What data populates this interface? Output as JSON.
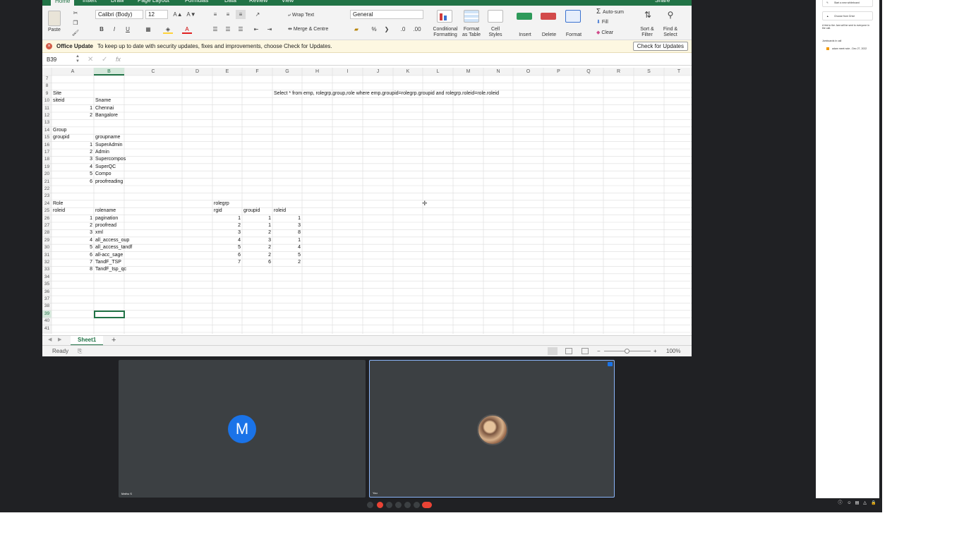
{
  "excel": {
    "tabs": [
      "Home",
      "Insert",
      "Draw",
      "Page Layout",
      "Formulas",
      "Data",
      "Review",
      "View"
    ],
    "share_label": "Share",
    "ribbon": {
      "paste": "Paste",
      "font_name": "Calibri (Body)",
      "font_size": "12",
      "wrap_text": "Wrap Text",
      "merge_centre": "Merge & Centre",
      "number_format": "General",
      "conditional_formatting": [
        "Conditional",
        "Formatting"
      ],
      "format_as_table": [
        "Format",
        "as Table"
      ],
      "cell_styles": [
        "Cell",
        "Styles"
      ],
      "insert": "Insert",
      "delete": "Delete",
      "format": "Format",
      "autosum": "Auto-sum",
      "fill": "Fill",
      "clear": "Clear",
      "sort_filter": [
        "Sort &",
        "Filter"
      ],
      "find_select": [
        "Find &",
        "Select"
      ],
      "bold": "B",
      "italic": "I",
      "underline": "U",
      "percent": "%"
    },
    "message_bar": {
      "title": "Office Update",
      "text": "To keep up to date with security updates, fixes and improvements, choose Check for Updates.",
      "button": "Check for Updates"
    },
    "formula_bar": {
      "name_box": "B39",
      "fx": "fx",
      "formula": ""
    },
    "columns": [
      "A",
      "B",
      "C",
      "D",
      "E",
      "F",
      "G",
      "H",
      "I",
      "J",
      "K",
      "L",
      "M",
      "N",
      "O",
      "P",
      "Q",
      "R",
      "S",
      "T"
    ],
    "rows": [
      7,
      8,
      9,
      10,
      11,
      12,
      13,
      14,
      15,
      16,
      17,
      18,
      19,
      20,
      21,
      22,
      23,
      24,
      25,
      26,
      27,
      28,
      29,
      30,
      31,
      32,
      33,
      34,
      35,
      36,
      37,
      38,
      39,
      40,
      41
    ],
    "cells": [
      {
        "r": 9,
        "c": "A",
        "v": "Site"
      },
      {
        "r": 9,
        "c": "G",
        "v": "Select * from emp, rolegrp,group,role where emp.groupid=rolegrp.groupid and rolegrp.roleid=role.roleid"
      },
      {
        "r": 10,
        "c": "A",
        "v": "siteid"
      },
      {
        "r": 10,
        "c": "B",
        "v": "Sname"
      },
      {
        "r": 11,
        "c": "A",
        "v": "1",
        "num": true
      },
      {
        "r": 11,
        "c": "B",
        "v": "Chennai"
      },
      {
        "r": 12,
        "c": "A",
        "v": "2",
        "num": true
      },
      {
        "r": 12,
        "c": "B",
        "v": "Bangalore"
      },
      {
        "r": 14,
        "c": "A",
        "v": "Group"
      },
      {
        "r": 15,
        "c": "A",
        "v": "groupid"
      },
      {
        "r": 15,
        "c": "B",
        "v": "groupname"
      },
      {
        "r": 16,
        "c": "A",
        "v": "1",
        "num": true
      },
      {
        "r": 16,
        "c": "B",
        "v": "SuperAdmin"
      },
      {
        "r": 17,
        "c": "A",
        "v": "2",
        "num": true
      },
      {
        "r": 17,
        "c": "B",
        "v": "Admin"
      },
      {
        "r": 18,
        "c": "A",
        "v": "3",
        "num": true
      },
      {
        "r": 18,
        "c": "B",
        "v": "Supercompos"
      },
      {
        "r": 19,
        "c": "A",
        "v": "4",
        "num": true
      },
      {
        "r": 19,
        "c": "B",
        "v": "SuperQC"
      },
      {
        "r": 20,
        "c": "A",
        "v": "5",
        "num": true
      },
      {
        "r": 20,
        "c": "B",
        "v": "Compo"
      },
      {
        "r": 21,
        "c": "A",
        "v": "6",
        "num": true
      },
      {
        "r": 21,
        "c": "B",
        "v": "proofreading"
      },
      {
        "r": 24,
        "c": "A",
        "v": "Role"
      },
      {
        "r": 24,
        "c": "E",
        "v": "rolegrp"
      },
      {
        "r": 25,
        "c": "A",
        "v": "roleid"
      },
      {
        "r": 25,
        "c": "B",
        "v": "rolename"
      },
      {
        "r": 25,
        "c": "E",
        "v": "rgid"
      },
      {
        "r": 25,
        "c": "F",
        "v": "groupid"
      },
      {
        "r": 25,
        "c": "G",
        "v": "roleid"
      },
      {
        "r": 26,
        "c": "A",
        "v": "1",
        "num": true
      },
      {
        "r": 26,
        "c": "B",
        "v": "pagination"
      },
      {
        "r": 26,
        "c": "E",
        "v": "1",
        "num": true
      },
      {
        "r": 26,
        "c": "F",
        "v": "1",
        "num": true
      },
      {
        "r": 26,
        "c": "G",
        "v": "1",
        "num": true
      },
      {
        "r": 27,
        "c": "A",
        "v": "2",
        "num": true
      },
      {
        "r": 27,
        "c": "B",
        "v": "proofread"
      },
      {
        "r": 27,
        "c": "E",
        "v": "2",
        "num": true
      },
      {
        "r": 27,
        "c": "F",
        "v": "1",
        "num": true
      },
      {
        "r": 27,
        "c": "G",
        "v": "3",
        "num": true
      },
      {
        "r": 28,
        "c": "A",
        "v": "3",
        "num": true
      },
      {
        "r": 28,
        "c": "B",
        "v": "xml"
      },
      {
        "r": 28,
        "c": "E",
        "v": "3",
        "num": true
      },
      {
        "r": 28,
        "c": "F",
        "v": "2",
        "num": true
      },
      {
        "r": 28,
        "c": "G",
        "v": "8",
        "num": true
      },
      {
        "r": 29,
        "c": "A",
        "v": "4",
        "num": true
      },
      {
        "r": 29,
        "c": "B",
        "v": "all_access_oup"
      },
      {
        "r": 29,
        "c": "E",
        "v": "4",
        "num": true
      },
      {
        "r": 29,
        "c": "F",
        "v": "3",
        "num": true
      },
      {
        "r": 29,
        "c": "G",
        "v": "1",
        "num": true
      },
      {
        "r": 30,
        "c": "A",
        "v": "5",
        "num": true
      },
      {
        "r": 30,
        "c": "B",
        "v": "all_access_tandf"
      },
      {
        "r": 30,
        "c": "E",
        "v": "5",
        "num": true
      },
      {
        "r": 30,
        "c": "F",
        "v": "2",
        "num": true
      },
      {
        "r": 30,
        "c": "G",
        "v": "4",
        "num": true
      },
      {
        "r": 31,
        "c": "A",
        "v": "6",
        "num": true
      },
      {
        "r": 31,
        "c": "B",
        "v": "all-acc_sage"
      },
      {
        "r": 31,
        "c": "E",
        "v": "6",
        "num": true
      },
      {
        "r": 31,
        "c": "F",
        "v": "2",
        "num": true
      },
      {
        "r": 31,
        "c": "G",
        "v": "5",
        "num": true
      },
      {
        "r": 32,
        "c": "A",
        "v": "7",
        "num": true
      },
      {
        "r": 32,
        "c": "B",
        "v": "TandF_TSP"
      },
      {
        "r": 32,
        "c": "E",
        "v": "7",
        "num": true
      },
      {
        "r": 32,
        "c": "F",
        "v": "6",
        "num": true
      },
      {
        "r": 32,
        "c": "G",
        "v": "2",
        "num": true
      },
      {
        "r": 33,
        "c": "A",
        "v": "8",
        "num": true
      },
      {
        "r": 33,
        "c": "B",
        "v": "TandF_tsp_qc"
      }
    ],
    "selected_cell": {
      "r": 39,
      "c": "B"
    },
    "sheet_tab": "Sheet1",
    "add_sheet": "+",
    "status": "Ready",
    "zoom": "100%",
    "colors": {
      "accent": "#217346",
      "message_bar": "#fdf7e1"
    }
  },
  "meet": {
    "tile1": {
      "avatar_letter": "M",
      "name": "Mathu S"
    },
    "tile2": {
      "name": "You"
    },
    "colors": {
      "avatar": "#1a73e8",
      "background": "#202124",
      "tile": "#3c4043",
      "end_call": "#ea4335"
    }
  },
  "side_panel": {
    "start_whiteboard": "Start a new whiteboard",
    "choose_drive": "Choose from Drive",
    "invite_text": "A link to the Jam will be sent to everyone in the call.",
    "section_title": "Jamboards in call",
    "jam_item": "adam meet note - Dec 27, 2022"
  }
}
